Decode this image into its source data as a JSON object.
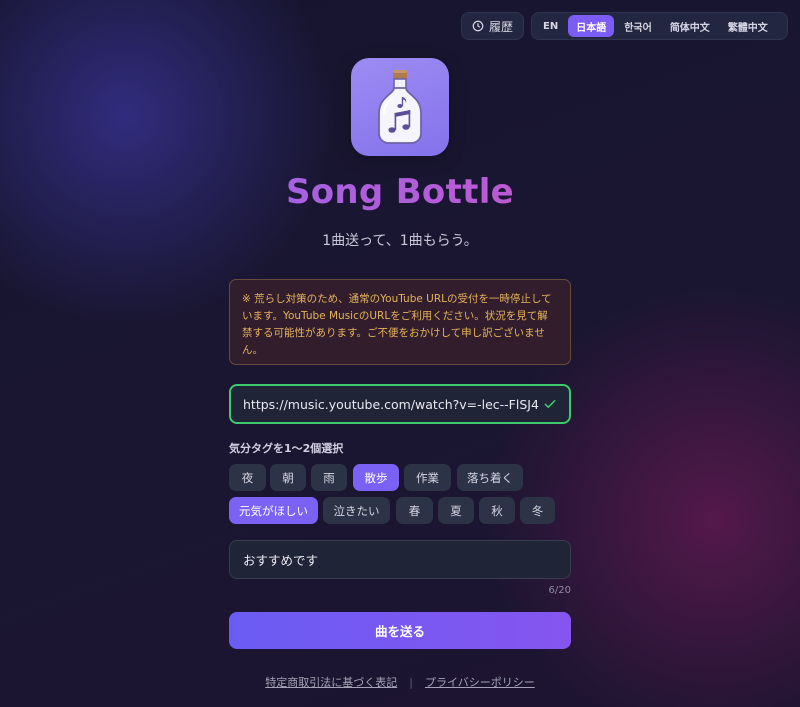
{
  "header": {
    "history_label": "履歴",
    "languages": [
      {
        "label": "EN",
        "active": false
      },
      {
        "label": "日本語",
        "active": true
      },
      {
        "label": "한국어",
        "active": false
      },
      {
        "label": "简体中文",
        "active": false
      },
      {
        "label": "繁體中文",
        "active": false
      }
    ]
  },
  "app": {
    "title": "Song Bottle",
    "tagline": "1曲送って、1曲もらう。"
  },
  "notice": {
    "text": "※ 荒らし対策のため、通常のYouTube URLの受付を一時停止しています。YouTube MusicのURLをご利用ください。状況を見て解禁する可能性があります。ご不便をおかけして申し訳ございません。"
  },
  "url_input": {
    "value": "https://music.youtube.com/watch?v=-lec--FlSJ4",
    "valid": true
  },
  "tags": {
    "label": "気分タグを1〜2個選択",
    "items": [
      {
        "label": "夜",
        "selected": false
      },
      {
        "label": "朝",
        "selected": false
      },
      {
        "label": "雨",
        "selected": false
      },
      {
        "label": "散歩",
        "selected": true
      },
      {
        "label": "作業",
        "selected": false
      },
      {
        "label": "落ち着く",
        "selected": false
      },
      {
        "label": "元気がほしい",
        "selected": true
      },
      {
        "label": "泣きたい",
        "selected": false
      },
      {
        "label": "春",
        "selected": false
      },
      {
        "label": "夏",
        "selected": false
      },
      {
        "label": "秋",
        "selected": false
      },
      {
        "label": "冬",
        "selected": false
      }
    ]
  },
  "comment": {
    "value": "おすすめです",
    "counter": "6/20"
  },
  "send_label": "曲を送る",
  "footer": {
    "legal_link": "特定商取引法に基づく表記",
    "separator": "|",
    "privacy_link": "プライバシーポリシー"
  },
  "colors": {
    "accent": "#7b5cf5",
    "valid_border": "#3dca6b",
    "notice_text": "#e6b35c"
  }
}
